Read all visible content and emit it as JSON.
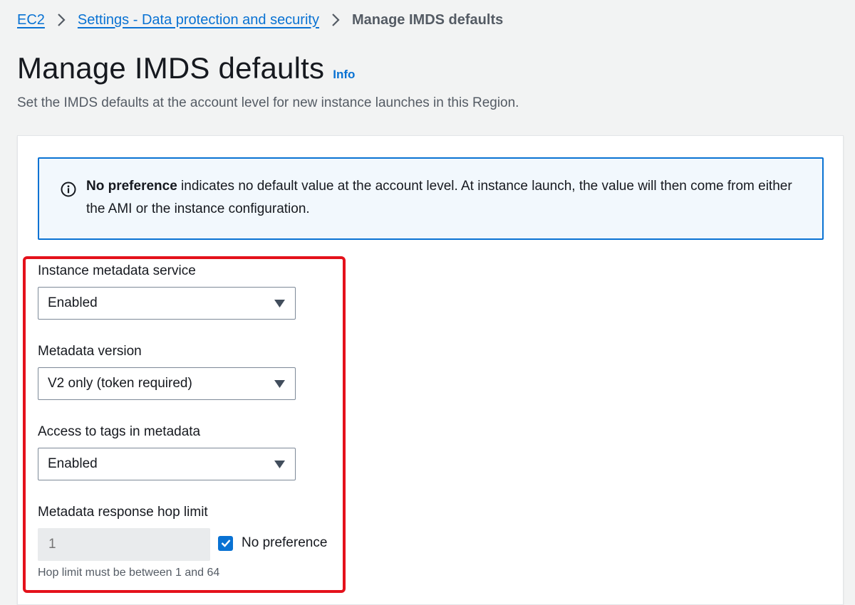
{
  "breadcrumb": {
    "items": [
      "EC2",
      "Settings - Data protection and security"
    ],
    "current": "Manage IMDS defaults"
  },
  "header": {
    "title": "Manage IMDS defaults",
    "info_label": "Info",
    "description": "Set the IMDS defaults at the account level for new instance launches in this Region."
  },
  "alert": {
    "icon": "info-circle-icon",
    "bold_text": "No preference",
    "text": " indicates no default value at the account level. At instance launch, the value will then come from either the AMI or the instance configuration."
  },
  "form": {
    "imds": {
      "label": "Instance metadata service",
      "value": "Enabled"
    },
    "version": {
      "label": "Metadata version",
      "value": "V2 only (token required)"
    },
    "tags": {
      "label": "Access to tags in metadata",
      "value": "Enabled"
    },
    "hop_limit": {
      "label": "Metadata response hop limit",
      "placeholder": "1",
      "checkbox_label": "No preference",
      "checkbox_checked": true,
      "constraint": "Hop limit must be between 1 and 64"
    }
  },
  "colors": {
    "link": "#0972d3",
    "highlight": "#e4111b",
    "background": "#f2f3f3",
    "alert_bg": "#f2f8fd"
  }
}
